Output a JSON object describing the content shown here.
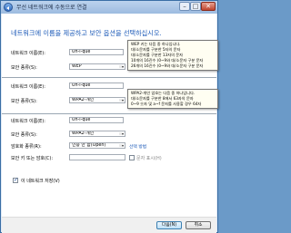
{
  "window": {
    "title": "무선 네트워크에 수동으로 연결",
    "controls": {
      "minimize": "–",
      "maximize": "□",
      "close": "✕"
    }
  },
  "heading": "네트워크에 이름을 제공하고 보안 옵션을 선택하십시오.",
  "section1": {
    "network_name_label": "네트워크 이름(E):",
    "network_name_value": "Un-i-que",
    "security_type_label": "보안 종류(S):",
    "security_type_value": "WEP"
  },
  "tooltip1": {
    "lines": [
      "WEP 키는 다음 중 하나입니다.",
      "대/소문자를 구분한 5자의 문자",
      "대/소문자를 구분한 13자의 문자",
      "10개의 16진수 (0~9와 대/소문자 구분 문자",
      "26개의 16진수 (0~9와 대/소문자 구분 문자"
    ]
  },
  "section2": {
    "network_name_label": "네트워크 이름(E):",
    "network_name_value": "Un-i-que",
    "security_type_label": "보안 종류(S):",
    "security_type_value": "WPA2-개인"
  },
  "tooltip2": {
    "lines": [
      "WPA2-개인 암호는 다음 중 하나입니다.",
      "대/소문자를 구분한 8에서 63자의 문자",
      "0~9 숫자 및 a~f 문자를 사용할 경우 64자"
    ]
  },
  "section3": {
    "network_name_label": "네트워크 이름(E):",
    "network_name_value": "Un-i-que",
    "security_type_label": "보안 종류(S):",
    "security_type_value": "WPA2-개인",
    "encryption_type_label": "암호화 종류(R):",
    "encryption_type_value": "AES",
    "security_key_label": "보안 키 또는 암호(C):",
    "security_key_value": "",
    "auto_type_value": "인증 안 함(Open)",
    "choose_link": "선택 방법",
    "show_chars_label": "문자 표시(H)",
    "save_network_label": "이 네트워크 저장(V)"
  },
  "footer": {
    "next_label": "다음(N)",
    "cancel_label": "취소"
  }
}
